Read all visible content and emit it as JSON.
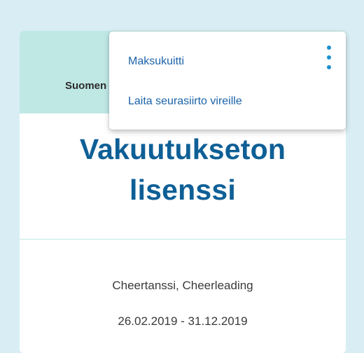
{
  "card": {
    "organization": "Suomen",
    "title_line1": "Vakuutukseton",
    "title_line2": "lisenssi",
    "sport": "Cheertanssi, Cheerleading",
    "period": "26.02.2019 - 31.12.2019"
  },
  "menu": {
    "items": [
      {
        "label": "Maksukuitti"
      },
      {
        "label": "Laita seurasiirto vireille"
      }
    ],
    "icon": "kebab-vertical-icon"
  },
  "colors": {
    "background": "#d8eef4",
    "header": "#bfe8e5",
    "title": "#0e5f96",
    "link": "#1b63a8",
    "kebab": "#1b8fd2"
  }
}
